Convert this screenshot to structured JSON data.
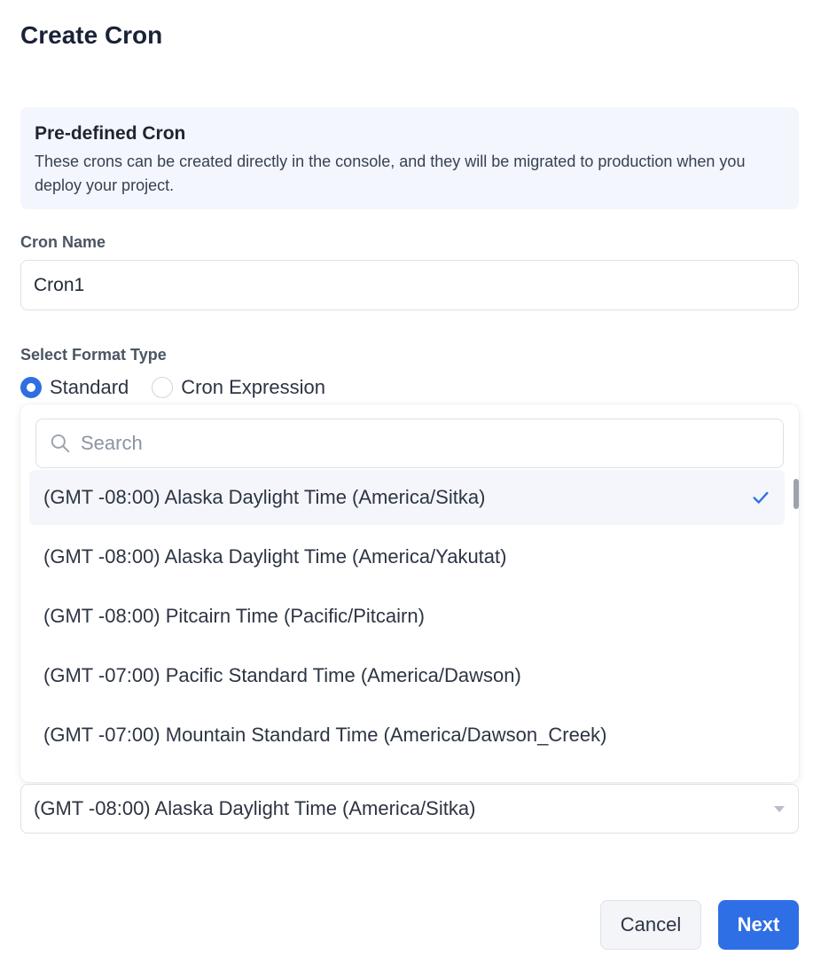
{
  "dialog": {
    "title": "Create Cron"
  },
  "info": {
    "title": "Pre-defined Cron",
    "description": "These crons can be created directly in the console, and they will be migrated to production when you deploy your project."
  },
  "cron_name": {
    "label": "Cron Name",
    "value": "Cron1"
  },
  "format_type": {
    "label": "Select Format Type",
    "options": [
      "Standard",
      "Cron Expression"
    ],
    "selected": "Standard"
  },
  "timezone_dropdown": {
    "search_placeholder": "Search",
    "options": [
      "(GMT -08:00) Alaska Daylight Time (America/Sitka)",
      "(GMT -08:00) Alaska Daylight Time (America/Yakutat)",
      "(GMT -08:00) Pitcairn Time (Pacific/Pitcairn)",
      "(GMT -07:00) Pacific Standard Time (America/Dawson)",
      "(GMT -07:00) Mountain Standard Time (America/Dawson_Creek)"
    ],
    "selected_value": "(GMT -08:00) Alaska Daylight Time (America/Sitka)"
  },
  "actions": {
    "cancel_label": "Cancel",
    "next_label": "Next"
  },
  "colors": {
    "primary": "#2f6fe6",
    "info_bg": "#f3f6fd",
    "title": "#1a2238"
  },
  "icons": {
    "search": "search-icon",
    "check": "check-icon",
    "caret": "caret-down-icon"
  }
}
